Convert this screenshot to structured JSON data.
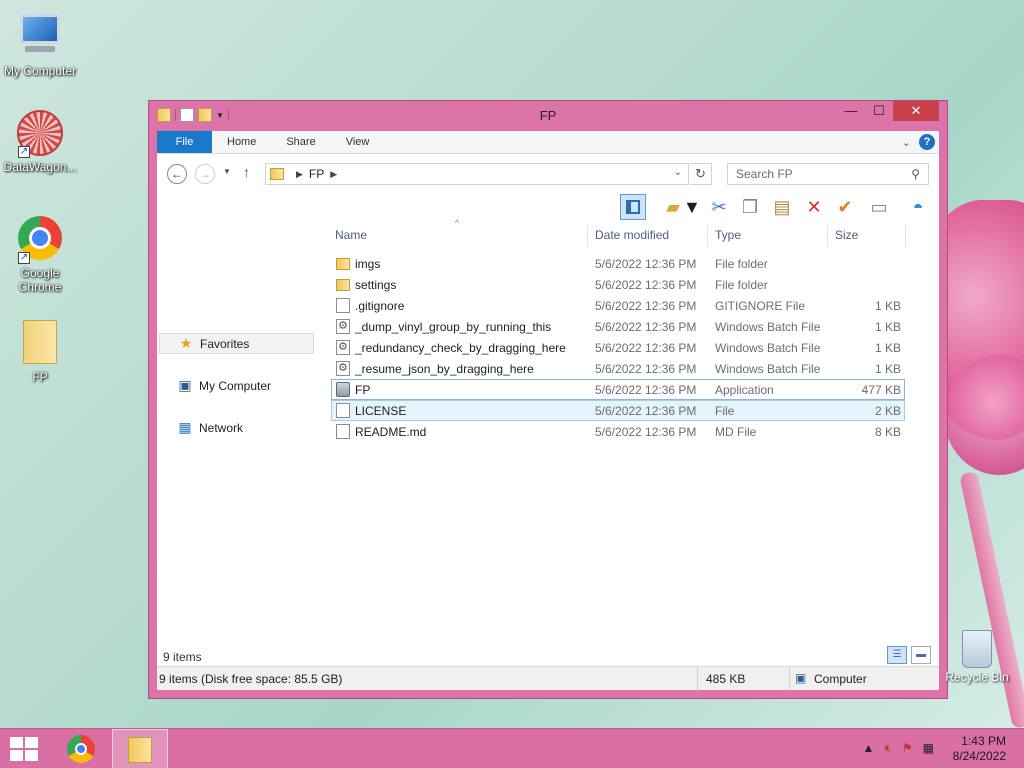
{
  "desktop": {
    "icons": [
      {
        "label": "My Computer"
      },
      {
        "label": "DataWagon..."
      },
      {
        "label": "Google Chrome"
      },
      {
        "label": "FP"
      }
    ],
    "recycle_bin": "Recycle Bin"
  },
  "window": {
    "title": "FP",
    "controls": {
      "minimize": "—",
      "maximize": "☐",
      "close": "✕"
    }
  },
  "ribbon": {
    "tabs": [
      "File",
      "Home",
      "Share",
      "View"
    ],
    "help": "?"
  },
  "address": {
    "crumbs": [
      "FP"
    ],
    "search_placeholder": "Search FP"
  },
  "nav_pane": {
    "items": [
      "Favorites",
      "My Computer",
      "Network"
    ]
  },
  "columns": [
    "Name",
    "Date modified",
    "Type",
    "Size"
  ],
  "files": [
    {
      "name": "imgs",
      "date": "5/6/2022 12:36 PM",
      "type": "File folder",
      "size": "",
      "icon": "folder-icon"
    },
    {
      "name": "settings",
      "date": "5/6/2022 12:36 PM",
      "type": "File folder",
      "size": "",
      "icon": "folder-icon"
    },
    {
      "name": ".gitignore",
      "date": "5/6/2022 12:36 PM",
      "type": "GITIGNORE File",
      "size": "1 KB",
      "icon": "file-icon"
    },
    {
      "name": "_dump_vinyl_group_by_running_this",
      "date": "5/6/2022 12:36 PM",
      "type": "Windows Batch File",
      "size": "1 KB",
      "icon": "batch-file-icon"
    },
    {
      "name": "_redundancy_check_by_dragging_here",
      "date": "5/6/2022 12:36 PM",
      "type": "Windows Batch File",
      "size": "1 KB",
      "icon": "batch-file-icon"
    },
    {
      "name": "_resume_json_by_dragging_here",
      "date": "5/6/2022 12:36 PM",
      "type": "Windows Batch File",
      "size": "1 KB",
      "icon": "batch-file-icon"
    },
    {
      "name": "FP",
      "date": "5/6/2022 12:36 PM",
      "type": "Application",
      "size": "477 KB",
      "icon": "application-icon"
    },
    {
      "name": "LICENSE",
      "date": "5/6/2022 12:36 PM",
      "type": "File",
      "size": "2 KB",
      "icon": "file-icon"
    },
    {
      "name": "README.md",
      "date": "5/6/2022 12:36 PM",
      "type": "MD File",
      "size": "8 KB",
      "icon": "file-icon"
    }
  ],
  "items_count": "9 items",
  "status": {
    "left": "9 items (Disk free space: 85.5 GB)",
    "size": "485 KB",
    "location": "Computer"
  },
  "taskbar": {
    "time": "1:43 PM",
    "date": "8/24/2022"
  },
  "colors": {
    "window_frame": "#dd74a9",
    "file_tab": "#1979ca",
    "taskbar": "#d96fa4"
  }
}
